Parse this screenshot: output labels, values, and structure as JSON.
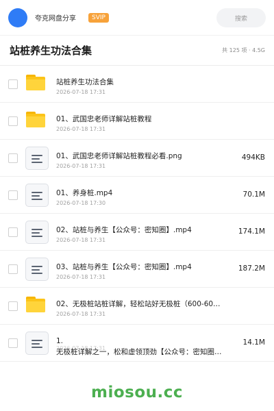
{
  "header": {
    "share_name": "夸克网盘分享",
    "badge": "SVIP",
    "search_placeholder": "搜索",
    "avatar_color": "#2f7cf6",
    "badge_color": "#f7a23a"
  },
  "folder": {
    "title": "站桩养生功法合集",
    "summary": "共 125 项 · 4.5G"
  },
  "files": [
    {
      "type": "folder-icon",
      "name": "站桩养生功法合集",
      "date": "2026-07-18 17:31",
      "size": ""
    },
    {
      "type": "folder-icon",
      "name": "01、武国忠老师详解站桩教程",
      "date": "2026-07-18 17:31",
      "size": ""
    },
    {
      "type": "document-icon",
      "name": "01、武国忠老师详解站桩教程必看.png",
      "date": "2026-07-18 17:31",
      "size": "494KB"
    },
    {
      "type": "document-icon",
      "name": "01、养身桩.mp4",
      "date": "2026-07-18 17:30",
      "size": "70.1M"
    },
    {
      "type": "document-icon",
      "name": "02、站桩与养生【公众号：密知圈】.mp4",
      "date": "2026-07-18 17:31",
      "size": "174.1M"
    },
    {
      "type": "document-icon",
      "name": "03、站桩与养生【公众号：密知圈】.mp4",
      "date": "2026-07-18 17:31",
      "size": "187.2M"
    },
    {
      "type": "folder-icon",
      "name": "02、无极桩站桩详解，轻松站好无极桩（600-60…",
      "date": "2026-07-18 17:31",
      "size": ""
    }
  ],
  "last_file": {
    "type": "document-icon",
    "name_line1": "1.",
    "name_line2": "无极桩详解之一，松和虚领顶劲【公众号：密知圈…",
    "date": "2026-07-18 17:31",
    "size": "14.1M"
  },
  "watermark": "miosou.cc",
  "colors": {
    "folder": "#fcc419",
    "watermark": "#4caf50"
  }
}
